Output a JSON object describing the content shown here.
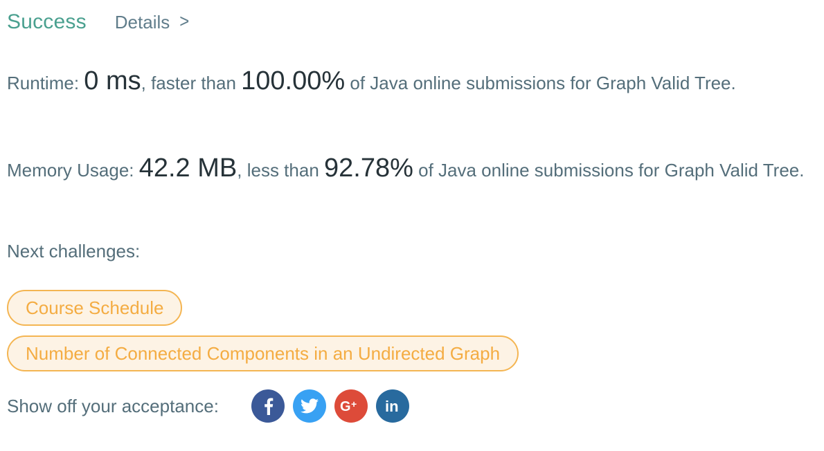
{
  "header": {
    "status": "Success",
    "details_label": "Details",
    "chevron": ">"
  },
  "runtime": {
    "label": "Runtime: ",
    "value": "0 ms",
    "mid": ", faster than ",
    "percent": "100.00%",
    "tail": " of Java online submissions for Graph Valid Tree."
  },
  "memory": {
    "label": "Memory Usage: ",
    "value": "42.2 MB",
    "mid": ", less than ",
    "percent": "92.78%",
    "tail": " of Java online submissions for Graph Valid Tree."
  },
  "next": {
    "label": "Next challenges:",
    "challenges": [
      "Course Schedule",
      "Number of Connected Components in an Undirected Graph"
    ]
  },
  "share": {
    "label": "Show off your acceptance:",
    "icons": [
      {
        "name": "facebook-icon",
        "color": "#3b5998"
      },
      {
        "name": "twitter-icon",
        "color": "#38a1f3"
      },
      {
        "name": "google-plus-icon",
        "color": "#dd4b39"
      },
      {
        "name": "linkedin-icon",
        "color": "#286a9e"
      }
    ]
  }
}
